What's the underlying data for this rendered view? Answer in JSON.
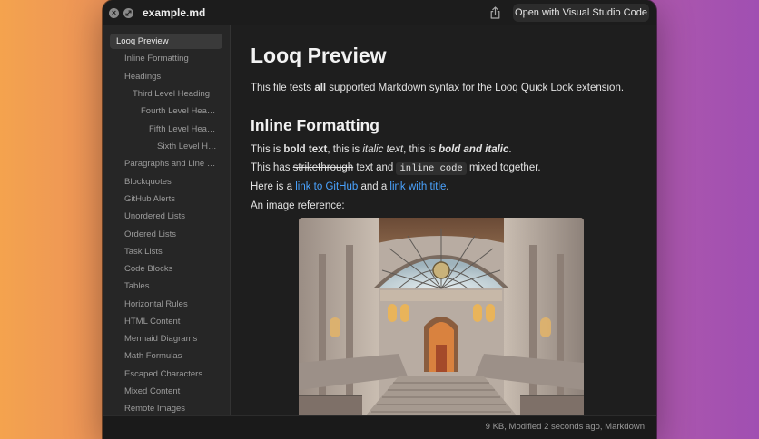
{
  "window": {
    "title": "example.md",
    "open_button_label": "Open with Visual Studio Code",
    "status": "9 KB, Modified 2 seconds ago, Markdown"
  },
  "sidebar": {
    "items": [
      {
        "label": "Looq Preview"
      },
      {
        "label": "Inline Formatting"
      },
      {
        "label": "Headings"
      },
      {
        "label": "Third Level Heading"
      },
      {
        "label": "Fourth Level Heading"
      },
      {
        "label": "Fifth Level Heading"
      },
      {
        "label": "Sixth Level Heading"
      },
      {
        "label": "Paragraphs and Line Breaks"
      },
      {
        "label": "Blockquotes"
      },
      {
        "label": "GitHub Alerts"
      },
      {
        "label": "Unordered Lists"
      },
      {
        "label": "Ordered Lists"
      },
      {
        "label": "Task Lists"
      },
      {
        "label": "Code Blocks"
      },
      {
        "label": "Tables"
      },
      {
        "label": "Horizontal Rules"
      },
      {
        "label": "HTML Content"
      },
      {
        "label": "Mermaid Diagrams"
      },
      {
        "label": "Math Formulas"
      },
      {
        "label": "Escaped Characters"
      },
      {
        "label": "Mixed Content"
      },
      {
        "label": "Remote Images"
      }
    ]
  },
  "content": {
    "h1": "Looq Preview",
    "intro": {
      "before": "This file tests ",
      "bold": "all",
      "after": " supported Markdown syntax for the Looq Quick Look extension."
    },
    "h2": "Inline Formatting",
    "line1": {
      "a": "This is ",
      "bold": "bold text",
      "b": ", this is ",
      "italic": "italic text",
      "c": ", this is ",
      "bolditalic": "bold and italic",
      "d": "."
    },
    "line2": {
      "a": "This has ",
      "strike": "strikethrough",
      "b": " text and ",
      "code": "inline code",
      "c": " mixed together."
    },
    "line3": {
      "a": "Here is a ",
      "link1": "link to GitHub",
      "b": " and a ",
      "link2": "link with title",
      "c": "."
    },
    "line4": "An image reference:"
  }
}
